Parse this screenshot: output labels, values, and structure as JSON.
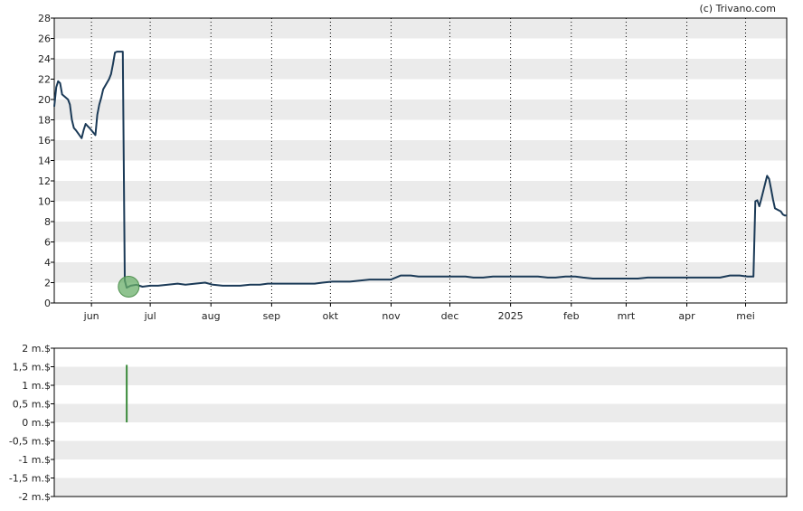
{
  "credit": "(c) Trivano.com",
  "colors": {
    "price_line": "#1b3a57",
    "marker_fill": "#6aaf6a",
    "volume_bar": "#3a8a3a",
    "band": "#ebebeb",
    "grid": "#000000"
  },
  "chart_data": [
    {
      "type": "line",
      "ylim": [
        0,
        28
      ],
      "y_ticks": [
        "0",
        "2",
        "4",
        "6",
        "8",
        "10",
        "12",
        "14",
        "16",
        "18",
        "20",
        "22",
        "24",
        "26",
        "28"
      ],
      "x_labels": [
        "jun",
        "jul",
        "aug",
        "sep",
        "okt",
        "nov",
        "dec",
        "2025",
        "feb",
        "mrt",
        "apr",
        "mei"
      ],
      "grid": "vertical dotted at month starts, horizontal alternating bands",
      "marker": {
        "date": "2024-06-20",
        "value": 1.6
      },
      "series": [
        {
          "values": [
            [
              "2024-05-13",
              19.3
            ],
            [
              "2024-05-14",
              21.2
            ],
            [
              "2024-05-15",
              21.8
            ],
            [
              "2024-05-16",
              21.6
            ],
            [
              "2024-05-17",
              20.5
            ],
            [
              "2024-05-20",
              20.0
            ],
            [
              "2024-05-21",
              19.5
            ],
            [
              "2024-05-22",
              18.0
            ],
            [
              "2024-05-23",
              17.2
            ],
            [
              "2024-05-24",
              17.0
            ],
            [
              "2024-05-27",
              16.2
            ],
            [
              "2024-05-28",
              17.0
            ],
            [
              "2024-05-29",
              17.6
            ],
            [
              "2024-05-30",
              17.4
            ],
            [
              "2024-05-31",
              17.2
            ],
            [
              "2024-06-03",
              16.5
            ],
            [
              "2024-06-04",
              18.5
            ],
            [
              "2024-06-05",
              19.5
            ],
            [
              "2024-06-06",
              20.2
            ],
            [
              "2024-06-07",
              21.0
            ],
            [
              "2024-06-10",
              22.0
            ],
            [
              "2024-06-11",
              22.5
            ],
            [
              "2024-06-12",
              23.5
            ],
            [
              "2024-06-13",
              24.6
            ],
            [
              "2024-06-14",
              24.7
            ],
            [
              "2024-06-17",
              24.7
            ],
            [
              "2024-06-18",
              2.2
            ],
            [
              "2024-06-19",
              1.5
            ],
            [
              "2024-06-20",
              1.6
            ],
            [
              "2024-06-21",
              1.7
            ],
            [
              "2024-06-24",
              1.8
            ],
            [
              "2024-06-27",
              1.6
            ],
            [
              "2024-07-01",
              1.7
            ],
            [
              "2024-07-05",
              1.7
            ],
            [
              "2024-07-10",
              1.8
            ],
            [
              "2024-07-15",
              1.9
            ],
            [
              "2024-07-19",
              1.8
            ],
            [
              "2024-07-24",
              1.9
            ],
            [
              "2024-07-29",
              2.0
            ],
            [
              "2024-08-02",
              1.8
            ],
            [
              "2024-08-07",
              1.7
            ],
            [
              "2024-08-12",
              1.7
            ],
            [
              "2024-08-16",
              1.7
            ],
            [
              "2024-08-21",
              1.8
            ],
            [
              "2024-08-26",
              1.8
            ],
            [
              "2024-08-30",
              1.9
            ],
            [
              "2024-09-04",
              1.9
            ],
            [
              "2024-09-09",
              1.9
            ],
            [
              "2024-09-13",
              1.9
            ],
            [
              "2024-09-18",
              1.9
            ],
            [
              "2024-09-23",
              1.9
            ],
            [
              "2024-09-27",
              2.0
            ],
            [
              "2024-10-02",
              2.1
            ],
            [
              "2024-10-07",
              2.1
            ],
            [
              "2024-10-11",
              2.1
            ],
            [
              "2024-10-16",
              2.2
            ],
            [
              "2024-10-21",
              2.3
            ],
            [
              "2024-10-25",
              2.3
            ],
            [
              "2024-10-30",
              2.3
            ],
            [
              "2024-11-01",
              2.3
            ],
            [
              "2024-11-06",
              2.7
            ],
            [
              "2024-11-11",
              2.7
            ],
            [
              "2024-11-15",
              2.6
            ],
            [
              "2024-11-20",
              2.6
            ],
            [
              "2024-11-25",
              2.6
            ],
            [
              "2024-11-29",
              2.6
            ],
            [
              "2024-12-04",
              2.6
            ],
            [
              "2024-12-09",
              2.6
            ],
            [
              "2024-12-13",
              2.5
            ],
            [
              "2024-12-18",
              2.5
            ],
            [
              "2024-12-23",
              2.6
            ],
            [
              "2024-12-30",
              2.6
            ],
            [
              "2025-01-06",
              2.6
            ],
            [
              "2025-01-10",
              2.6
            ],
            [
              "2025-01-15",
              2.6
            ],
            [
              "2025-01-20",
              2.5
            ],
            [
              "2025-01-24",
              2.5
            ],
            [
              "2025-01-29",
              2.6
            ],
            [
              "2025-02-03",
              2.6
            ],
            [
              "2025-02-07",
              2.5
            ],
            [
              "2025-02-12",
              2.4
            ],
            [
              "2025-02-17",
              2.4
            ],
            [
              "2025-02-21",
              2.4
            ],
            [
              "2025-02-26",
              2.4
            ],
            [
              "2025-03-03",
              2.4
            ],
            [
              "2025-03-07",
              2.4
            ],
            [
              "2025-03-12",
              2.5
            ],
            [
              "2025-03-17",
              2.5
            ],
            [
              "2025-03-21",
              2.5
            ],
            [
              "2025-03-26",
              2.5
            ],
            [
              "2025-03-31",
              2.5
            ],
            [
              "2025-04-04",
              2.5
            ],
            [
              "2025-04-09",
              2.5
            ],
            [
              "2025-04-14",
              2.5
            ],
            [
              "2025-04-18",
              2.5
            ],
            [
              "2025-04-23",
              2.7
            ],
            [
              "2025-04-28",
              2.7
            ],
            [
              "2025-05-02",
              2.6
            ],
            [
              "2025-05-05",
              2.6
            ],
            [
              "2025-05-06",
              10.0
            ],
            [
              "2025-05-07",
              10.1
            ],
            [
              "2025-05-08",
              9.5
            ],
            [
              "2025-05-09",
              10.2
            ],
            [
              "2025-05-12",
              12.5
            ],
            [
              "2025-05-13",
              12.2
            ],
            [
              "2025-05-14",
              11.2
            ],
            [
              "2025-05-15",
              10.2
            ],
            [
              "2025-05-16",
              9.3
            ],
            [
              "2025-05-19",
              9.0
            ],
            [
              "2025-05-20",
              8.7
            ],
            [
              "2025-05-21",
              8.6
            ],
            [
              "2025-05-22",
              8.6
            ]
          ]
        }
      ]
    },
    {
      "type": "bar",
      "ylim": [
        -2,
        2
      ],
      "y_ticks": [
        "-2 m.$",
        "-1,5 m.$",
        "-1 m.$",
        "-0,5 m.$",
        "0 m.$",
        "0,5 m.$",
        "1 m.$",
        "1,5 m.$",
        "2 m.$"
      ],
      "grid": "horizontal alternating bands",
      "bars": [
        {
          "date": "2024-06-19",
          "value": 1.55
        }
      ]
    }
  ]
}
